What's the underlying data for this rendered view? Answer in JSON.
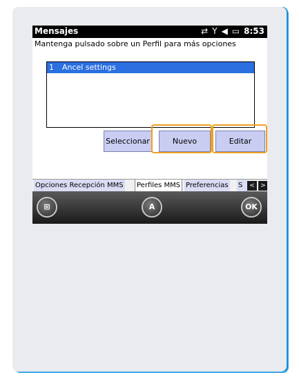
{
  "status_bar": {
    "title": "Mensajes",
    "icons": [
      "sync-icon",
      "signal-icon",
      "volume-icon",
      "battery-icon"
    ],
    "time": "8:53"
  },
  "instruction": "Mantenga pulsado sobre un Perfil para más opciones",
  "profiles": [
    {
      "num": "1",
      "label": "Ancel settings"
    }
  ],
  "buttons": {
    "select": "Seleccionar",
    "new": "Nuevo",
    "edit": "Editar"
  },
  "tabs": [
    {
      "label": "Opciones Recepción MMS"
    },
    {
      "label": "Perfiles MMS"
    },
    {
      "label": "Preferencias"
    },
    {
      "label": "S"
    }
  ],
  "softkeys": {
    "start": "start-icon",
    "keyboard": "A",
    "ok": "OK"
  },
  "colors": {
    "selection": "#2b6fe0",
    "button": "#c9cdf2",
    "highlight": "#f0a020"
  }
}
